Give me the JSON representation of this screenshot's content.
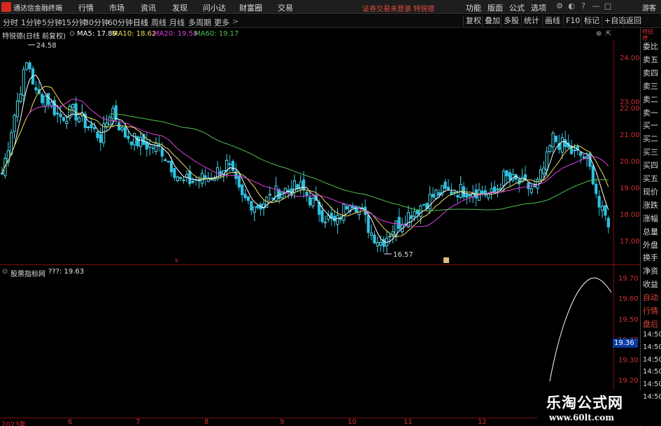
{
  "menubar": {
    "app_title": "通达信金融终端",
    "menus": [
      "行情",
      "市场",
      "资讯",
      "发现",
      "问小达",
      "财富圈",
      "交易"
    ],
    "notice": "证券交易未登录  特锐德",
    "right_items": [
      "功能",
      "版面",
      "公式",
      "选项"
    ],
    "guest": "游客"
  },
  "toolbar": {
    "periods": [
      "分时",
      "1分钟",
      "5分钟",
      "15分钟",
      "30分钟",
      "60分钟",
      "日线",
      "周线",
      "月线",
      "多周期",
      "更多"
    ],
    "active_period": "日线",
    "right_buttons": [
      "复权",
      "叠加",
      "多股",
      "统计",
      "画线",
      "F10",
      "标记",
      "+自选",
      "返回"
    ]
  },
  "main_chart": {
    "stock_label": "特锐德(日线 前复权)",
    "ma_items": [
      {
        "label": "MA5: 17.89",
        "color": "#ffffff"
      },
      {
        "label": "MA10: 18.62",
        "color": "#f0e060"
      },
      {
        "label": "MA20: 19.58",
        "color": "#e040e0"
      },
      {
        "label": "MA60: 19.17",
        "color": "#50c050"
      }
    ],
    "high_marker": "24.58",
    "low_marker": "16.57",
    "y_ticks": [
      "24.00",
      "23.00",
      "22.00",
      "21.00",
      "20.00",
      "19.00",
      "18.00",
      "17.00"
    ]
  },
  "sub_chart": {
    "indicator_label": "股票指标网",
    "value_label": "???: 19.63",
    "y_ticks": [
      "19.70",
      "19.60",
      "19.50",
      "19.40",
      "19.30",
      "19.20"
    ],
    "current_value": "19.36"
  },
  "date_axis": [
    "2023年",
    "6",
    "7",
    "8",
    "9",
    "10",
    "11",
    "12"
  ],
  "side_panel": {
    "header": [
      "特锐",
      "德"
    ],
    "items": [
      "委比",
      "卖五",
      "卖四",
      "卖三",
      "卖二",
      "卖一",
      "买一",
      "买二",
      "买三",
      "买四",
      "买五",
      "现价",
      "涨跌",
      "涨幅",
      "总量",
      "外盘",
      "换手",
      "净资",
      "收益",
      "自动",
      "行情",
      "盘后"
    ],
    "times": [
      "14:50",
      "14:50",
      "14:50",
      "14:50",
      "14:50",
      "14:50"
    ]
  },
  "watermark": {
    "title": "乐淘公式网",
    "url": "www.60lt.com"
  },
  "colors": {
    "up": "#50d8e8",
    "down": "#2ec0e0",
    "ma5": "#ffffff",
    "ma10": "#f0e060",
    "ma20": "#e040e0",
    "ma60": "#50c050",
    "axis": "#d03030",
    "border": "#7a1010"
  }
}
